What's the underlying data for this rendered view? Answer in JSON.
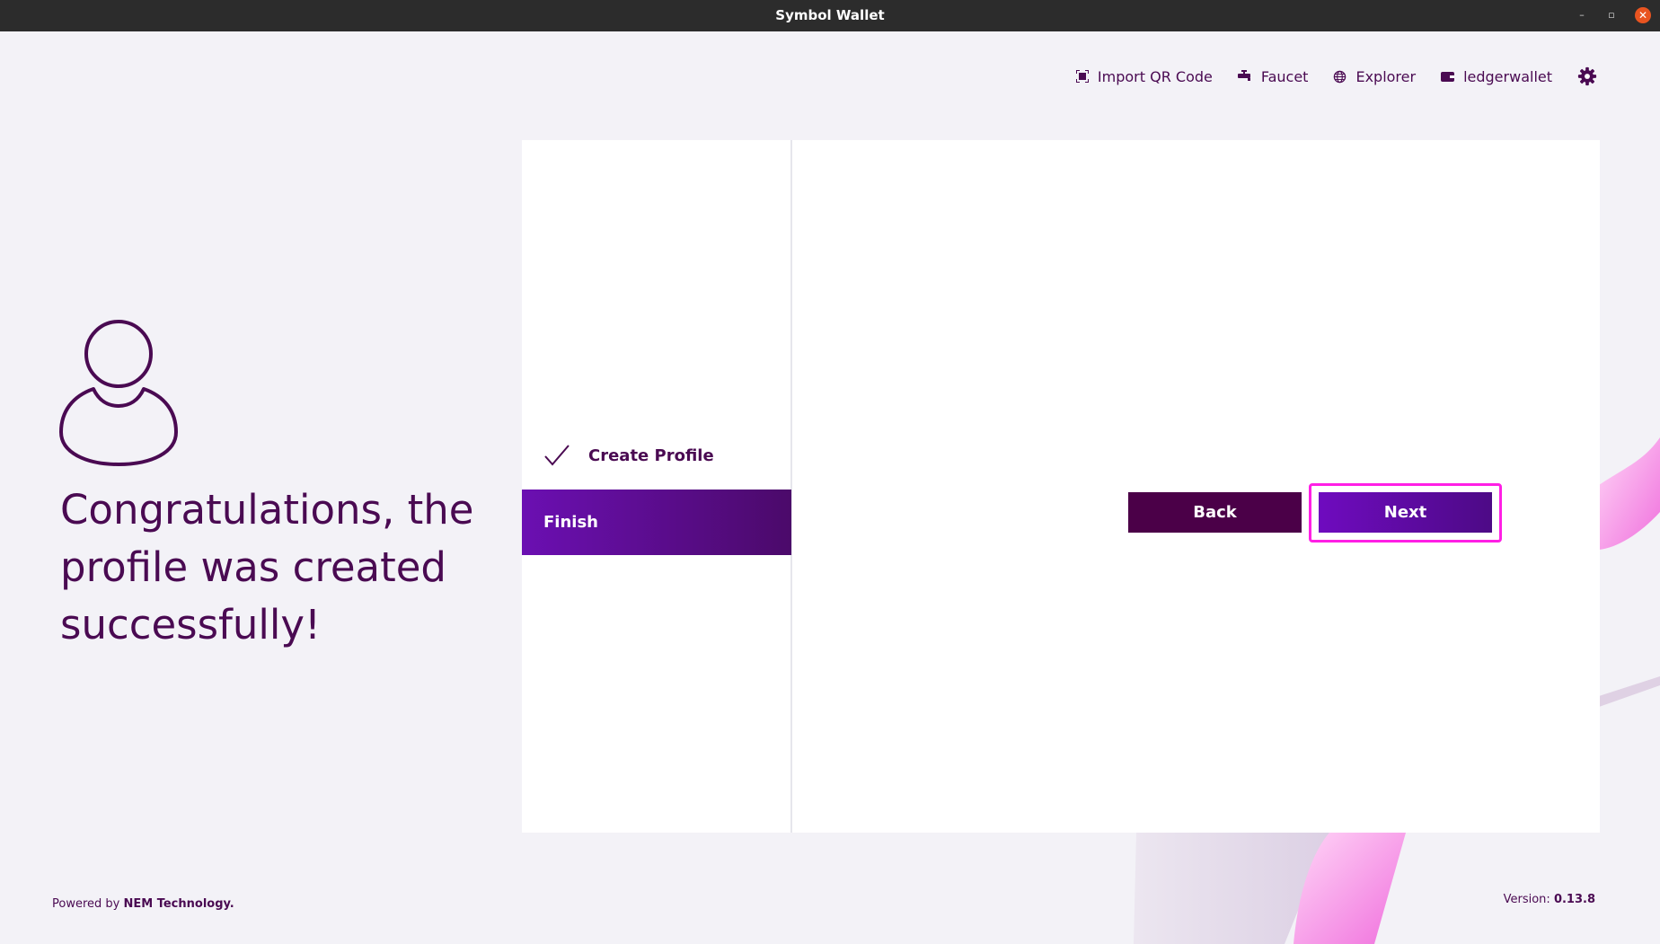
{
  "window": {
    "title": "Symbol Wallet",
    "controls": {
      "minimize": "–",
      "maximize": "▫",
      "close": "✕"
    }
  },
  "topnav": {
    "items": [
      {
        "label": "Import QR Code",
        "icon": "qr-code-icon"
      },
      {
        "label": "Faucet",
        "icon": "faucet-icon"
      },
      {
        "label": "Explorer",
        "icon": "globe-icon"
      },
      {
        "label": "ledgerwallet",
        "icon": "wallet-icon"
      }
    ],
    "settings_icon": "gear-icon"
  },
  "intro": {
    "message": "Congratulations, the profile was created successfully!",
    "avatar_icon": "user-profile-icon"
  },
  "steps": [
    {
      "label": "Create Profile",
      "state": "done"
    },
    {
      "label": "Finish",
      "state": "active"
    }
  ],
  "buttons": {
    "back": "Back",
    "next": "Next"
  },
  "footer": {
    "powered_prefix": "Powered by",
    "powered_brand": "NEM Technology.",
    "version_label": "Version:",
    "version_value": "0.13.8"
  },
  "colors": {
    "primary": "#4a0a52",
    "accent": "#6b0fb2",
    "highlight": "#ff1fe5",
    "background": "#f3f2f7",
    "titlebar": "#2c2c2c",
    "close": "#e95420"
  }
}
